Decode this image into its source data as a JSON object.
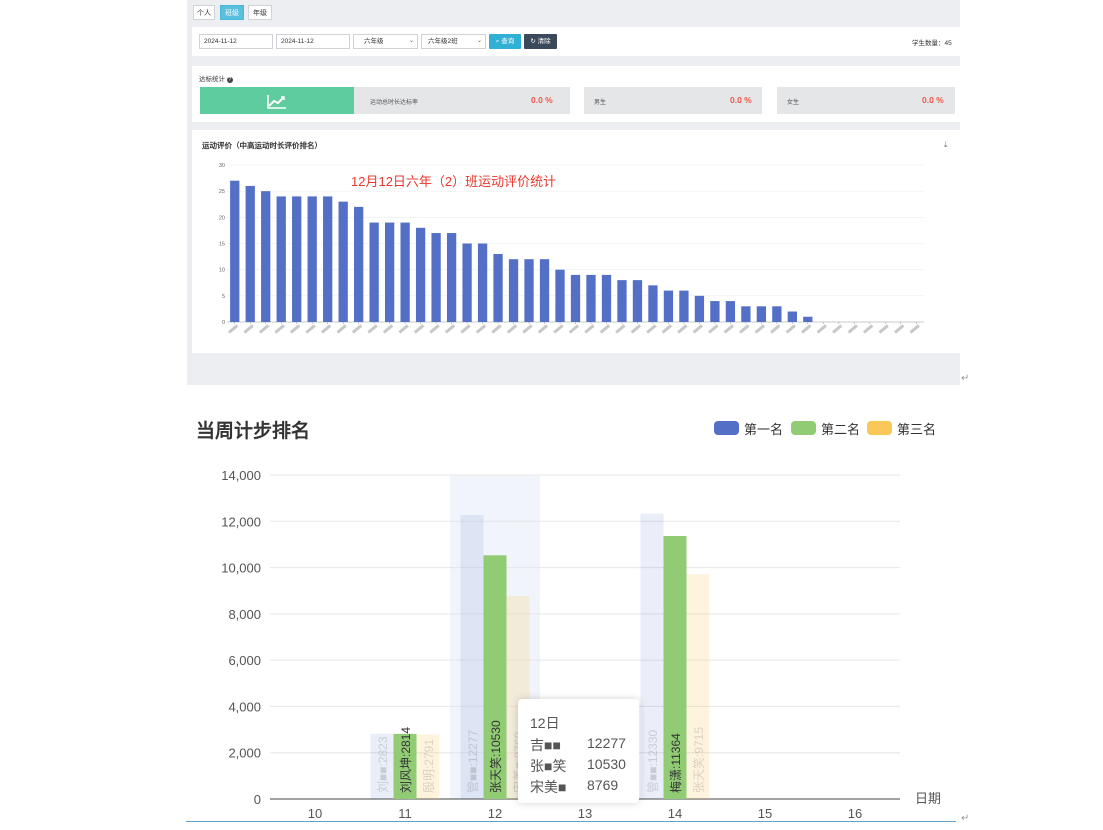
{
  "tabs": [
    {
      "label": "个人",
      "active": false
    },
    {
      "label": "班级",
      "active": true
    },
    {
      "label": "年级",
      "active": false
    }
  ],
  "filters": {
    "start_date": "2024-11-12",
    "end_date": "2024-11-12",
    "grade": "六年级",
    "class": "六年级2班",
    "search_label": "查询",
    "clear_label": "清除",
    "student_count": "学生数量：45"
  },
  "stats": {
    "title": "达标统计",
    "items": [
      {
        "label": "运动总时长达标率",
        "value": "0.0 %"
      },
      {
        "label": "男生",
        "value": "0.0 %"
      },
      {
        "label": "女生",
        "value": "0.0 %"
      }
    ]
  },
  "chart_data": [
    {
      "type": "bar",
      "title": "运动评价（中高运动时长评价排名）",
      "annotation": "12月12日六年（2）班运动评价统计",
      "color": "#5470c6",
      "ylim": [
        0,
        30
      ],
      "yticks": [
        0,
        5,
        10,
        15,
        20,
        25,
        30
      ],
      "grid": true,
      "values": [
        27,
        26,
        25,
        24,
        24,
        24,
        24,
        23,
        22,
        19,
        19,
        19,
        18,
        17,
        17,
        15,
        15,
        13,
        12,
        12,
        12,
        10,
        9,
        9,
        9,
        8,
        8,
        7,
        6,
        6,
        5,
        4,
        4,
        3,
        3,
        3,
        2,
        1,
        0,
        0,
        0,
        0,
        0,
        0,
        0
      ]
    },
    {
      "type": "bar",
      "title": "当周计步排名",
      "xlabel": "日期",
      "categories": [
        "10",
        "11",
        "12",
        "13",
        "14",
        "15",
        "16"
      ],
      "ylim": [
        0,
        14000
      ],
      "yticks": [
        "0",
        "2,000",
        "4,000",
        "6,000",
        "8,000",
        "10,000",
        "12,000",
        "14,000"
      ],
      "grid": true,
      "legend_position": "top-right",
      "series": [
        {
          "name": "第一名",
          "color": "#5470c6",
          "values": [
            null,
            2823,
            12277,
            null,
            12330,
            null,
            null
          ],
          "labels": [
            "",
            "刘■■:2823",
            "管■■:12277",
            "",
            "管■■:12330",
            "",
            ""
          ]
        },
        {
          "name": "第二名",
          "color": "#91cc75",
          "values": [
            null,
            2814,
            10530,
            null,
            11364,
            null,
            null
          ],
          "labels": [
            "",
            "刘风坤:2814",
            "张天笑:10530",
            "",
            "梅潇:11364",
            "",
            ""
          ]
        },
        {
          "name": "第三名",
          "color": "#fac858",
          "values": [
            null,
            2791,
            8769,
            null,
            9715,
            null,
            null
          ],
          "labels": [
            "",
            "殷明:2791",
            "宋美■:8769",
            "",
            "张天笑:9715",
            "",
            ""
          ]
        }
      ],
      "tooltip": {
        "title": "12日",
        "rows": [
          {
            "name": "吉■■",
            "value": "12277"
          },
          {
            "name": "张■笑",
            "value": "10530"
          },
          {
            "name": "宋美■",
            "value": "8769"
          }
        ]
      }
    }
  ]
}
